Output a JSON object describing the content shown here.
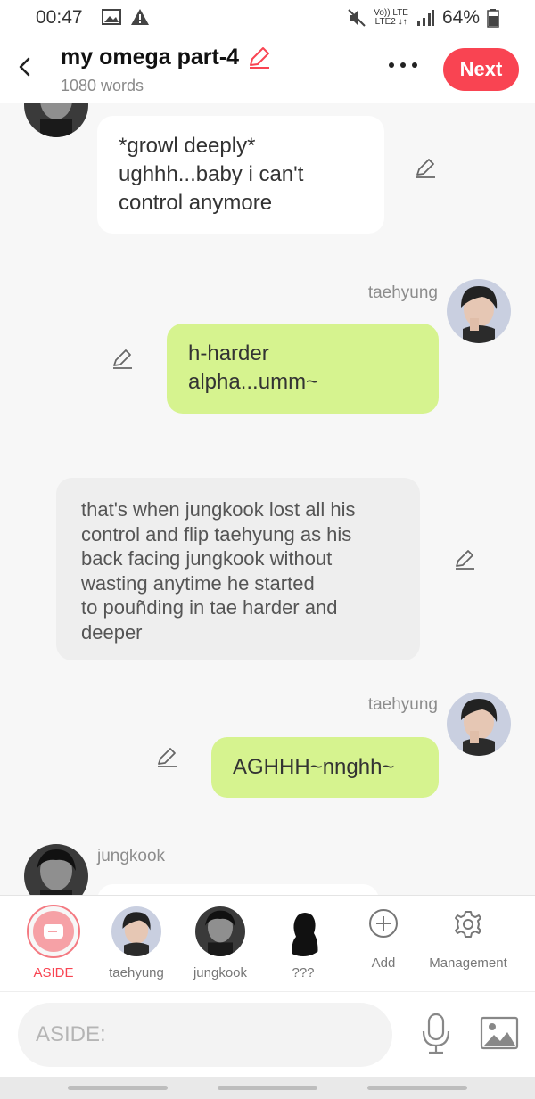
{
  "status_bar": {
    "time": "00:47",
    "network_line1": "Vo)) LTE",
    "network_line2": "LTE2 ↓↑",
    "battery": "64%"
  },
  "header": {
    "title": "my omega part-4",
    "word_count": "1080 words",
    "next_label": "Next",
    "accent_color": "#f94452"
  },
  "messages": [
    {
      "type": "character",
      "side": "left",
      "speaker": "jungkook",
      "text": "*growl deeply*\nughhh...baby i can't\ncontrol anymore"
    },
    {
      "type": "character",
      "side": "right",
      "speaker": "taehyung",
      "name_label": "taehyung",
      "text": "h-harder\nalpha...umm~"
    },
    {
      "type": "aside",
      "text": "that's when jungkook lost all his\ncontrol and flip taehyung as his\nback facing jungkook without\nwasting anytime he started\nto pouñding in tae harder and\ndeeper"
    },
    {
      "type": "character",
      "side": "right",
      "speaker": "taehyung",
      "name_label": "taehyung",
      "text": "AGHHH~nnghh~"
    },
    {
      "type": "character",
      "side": "left",
      "speaker": "jungkook",
      "name_label": "jungkook",
      "text": ""
    }
  ],
  "character_bar": {
    "aside_label": "ASIDE",
    "characters": [
      {
        "label": "taehyung"
      },
      {
        "label": "jungkook"
      },
      {
        "label": "???"
      }
    ],
    "add_label": "Add",
    "management_label": "Management"
  },
  "input": {
    "placeholder": "ASIDE:"
  },
  "colors": {
    "green_bubble": "#d6f38f",
    "white_bubble": "#ffffff",
    "aside_bubble": "#eeeeee",
    "background": "#f7f7f7"
  }
}
